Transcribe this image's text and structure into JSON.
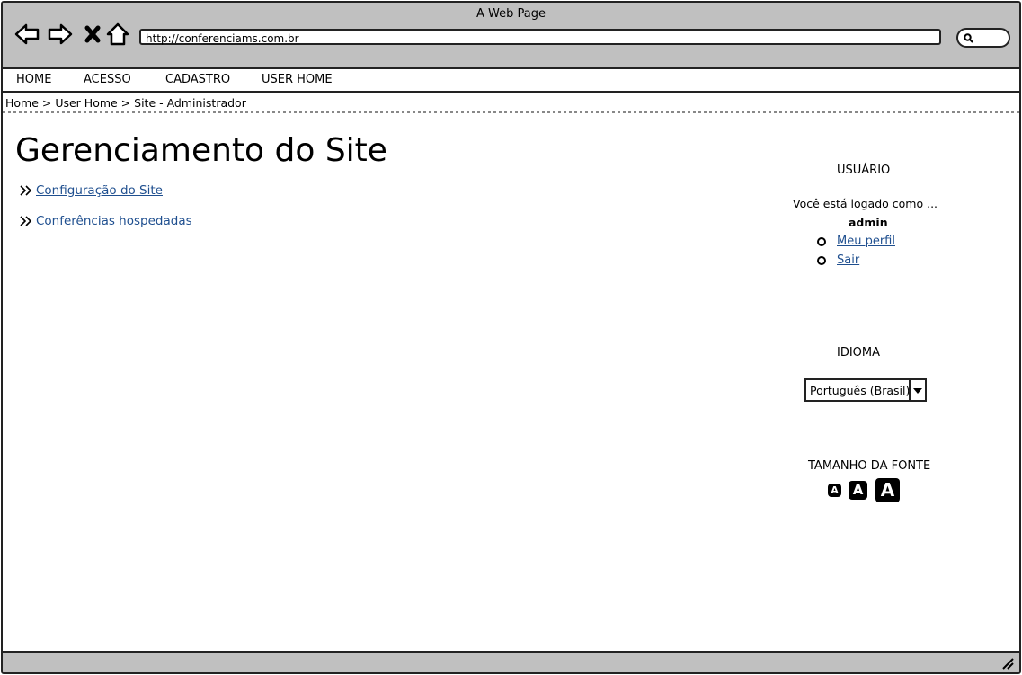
{
  "window": {
    "title": "A Web Page"
  },
  "browser": {
    "url": "http://conferenciams.com.br",
    "buttons": [
      "back-icon",
      "forward-icon",
      "close-icon",
      "home-icon",
      "search-icon"
    ]
  },
  "menu": {
    "items": [
      {
        "label": "HOME"
      },
      {
        "label": "ACESSO"
      },
      {
        "label": "CADASTRO"
      },
      {
        "label": "USER HOME"
      }
    ]
  },
  "breadcrumb": "Home > User Home > Site - Administrador",
  "main": {
    "title": "Gerenciamento do Site",
    "links": [
      {
        "label": "Configuração do Site"
      },
      {
        "label": "Conferências hospedadas"
      }
    ]
  },
  "sidebar": {
    "user_heading": "USUÁRIO",
    "logged_as": "Você está logado  como ...",
    "username": "admin",
    "user_links": [
      {
        "label": "Meu perfil"
      },
      {
        "label": "Sair"
      }
    ],
    "language_heading": "IDIOMA",
    "language_selected": "Português (Brasil)",
    "font_heading": "TAMANHO DA FONTE",
    "font_sizes": [
      "A",
      "A",
      "A"
    ]
  }
}
